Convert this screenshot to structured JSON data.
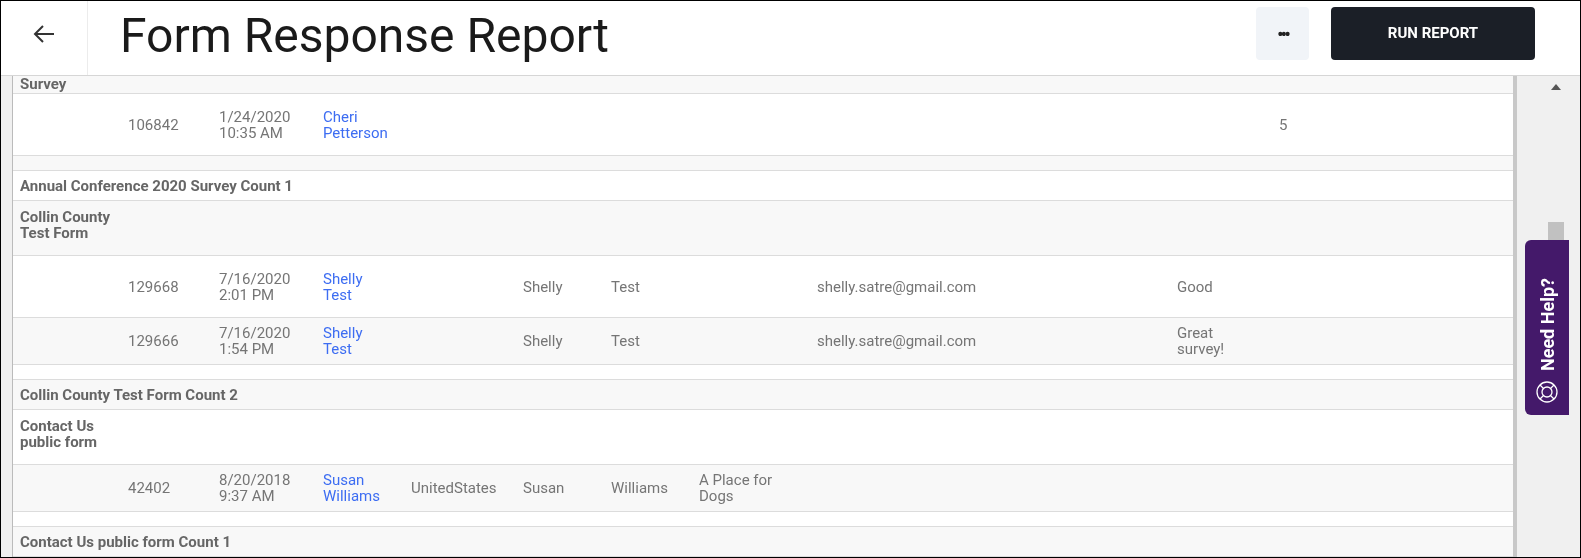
{
  "header": {
    "title": "Form Response Report",
    "run_button": "RUN REPORT",
    "more_button": "•••"
  },
  "rows": [
    {
      "kind": "form",
      "text": "Survey"
    },
    {
      "kind": "response",
      "response_id": "106842",
      "date": "1/24/2020",
      "time": "10:35 AM",
      "submitter": "Cheri Petterson",
      "column_11": "5"
    },
    {
      "kind": "spacer"
    },
    {
      "kind": "count",
      "text": "Annual Conference 2020 Survey Count 1"
    },
    {
      "kind": "form",
      "text": "Collin County Test Form"
    },
    {
      "kind": "response",
      "response_id": "129668",
      "date": "7/16/2020",
      "time": "2:01 PM",
      "submitter": "Shelly Test",
      "first_name": "Shelly",
      "last_name": "Test",
      "email": "shelly.satre@gmail.com",
      "column_10": "Good"
    },
    {
      "kind": "response",
      "response_id": "129666",
      "date": "7/16/2020",
      "time": "1:54 PM",
      "submitter": "Shelly Test",
      "first_name": "Shelly",
      "last_name": "Test",
      "email": "shelly.satre@gmail.com",
      "column_10": "Great survey!"
    },
    {
      "kind": "spacer"
    },
    {
      "kind": "count",
      "text": "Collin County Test Form Count 2"
    },
    {
      "kind": "form",
      "text": "Contact Us public form"
    },
    {
      "kind": "response",
      "response_id": "42402",
      "date": "8/20/2018",
      "time": "9:37 AM",
      "submitter": "Susan Williams",
      "country": "UnitedStates",
      "first_name": "Susan",
      "last_name": "Williams",
      "column_8": "A Place for Dogs"
    },
    {
      "kind": "spacer"
    },
    {
      "kind": "count",
      "text": "Contact Us public form Count 1"
    }
  ],
  "help_tab": {
    "label": "Need Help?"
  }
}
